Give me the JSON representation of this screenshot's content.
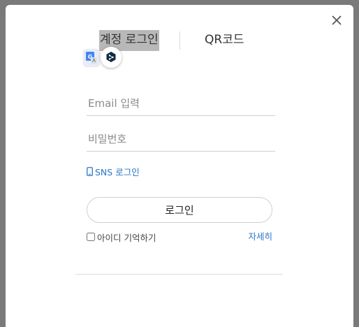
{
  "tabs": {
    "account_login": "계정 로그인",
    "qr_code": "QR코드"
  },
  "form": {
    "email_placeholder": "Email 입력",
    "password_placeholder": "비밀번호",
    "sns_login": "SNS 로그인",
    "login_button": "로그인",
    "remember_id": "아이디 기억하기",
    "details_link": "자세히"
  },
  "colors": {
    "link": "#2a76c8",
    "overlay": "#7a7a7a",
    "active_tab_highlight": "#b8b8b8"
  },
  "icons": {
    "close": "close-icon",
    "phone": "phone-icon",
    "translate_extension": "google-translate-icon",
    "deepl_extension": "deepl-icon"
  }
}
